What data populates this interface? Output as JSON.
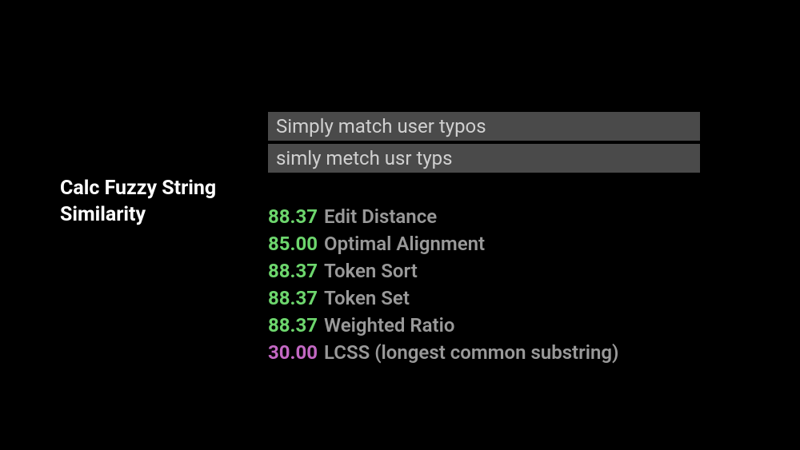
{
  "title": {
    "line1": "Calc Fuzzy String",
    "line2": "Similarity"
  },
  "inputs": {
    "string1": "Simply match user typos",
    "string2": "simly metch usr typs"
  },
  "results": [
    {
      "value": "88.37",
      "label": "Edit Distance",
      "colorClass": "color-green"
    },
    {
      "value": "85.00",
      "label": "Optimal Alignment",
      "colorClass": "color-green"
    },
    {
      "value": "88.37",
      "label": "Token Sort",
      "colorClass": "color-green"
    },
    {
      "value": "88.37",
      "label": "Token Set",
      "colorClass": "color-green"
    },
    {
      "value": "88.37",
      "label": "Weighted Ratio",
      "colorClass": "color-green"
    },
    {
      "value": "30.00",
      "label": "LCSS (longest common substring)",
      "colorClass": "color-purple"
    }
  ]
}
